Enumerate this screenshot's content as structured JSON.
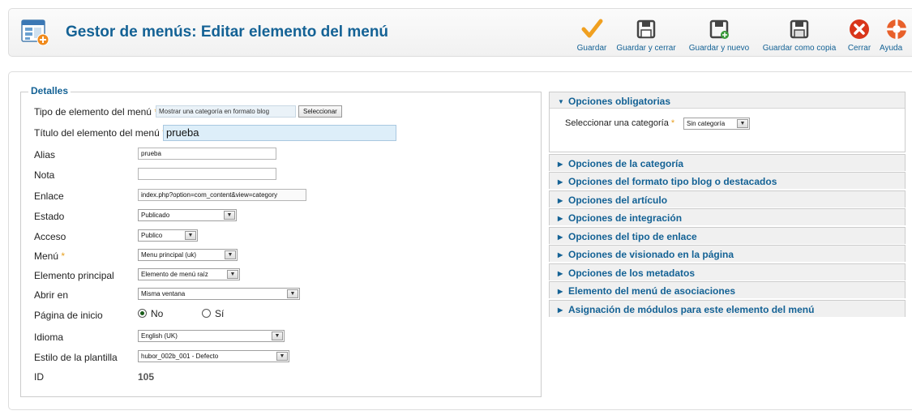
{
  "header": {
    "title": "Gestor de menús: Editar elemento del menú",
    "toolbar": [
      {
        "label": "Guardar",
        "icon": "checkmark-icon"
      },
      {
        "label": "Guardar y cerrar",
        "icon": "save-close-icon"
      },
      {
        "label": "Guardar y nuevo",
        "icon": "save-new-icon"
      },
      {
        "label": "Guardar como copia",
        "icon": "save-copy-icon"
      },
      {
        "label": "Cerrar",
        "icon": "close-icon"
      },
      {
        "label": "Ayuda",
        "icon": "help-icon"
      }
    ]
  },
  "details": {
    "legend": "Detalles",
    "required_marker": "*",
    "menu_item_type": {
      "label": "Tipo de elemento del menú",
      "value": "Mostrar una categoría en formato blog",
      "button": "Seleccionar"
    },
    "title": {
      "label": "Título del elemento del menú",
      "value": "prueba"
    },
    "alias": {
      "label": "Alias",
      "value": "prueba"
    },
    "note": {
      "label": "Nota",
      "value": ""
    },
    "link": {
      "label": "Enlace",
      "value": "index.php?option=com_content&view=category"
    },
    "status": {
      "label": "Estado",
      "value": "Publicado"
    },
    "access": {
      "label": "Acceso",
      "value": "Publico"
    },
    "menu": {
      "label": "Menú",
      "value": "Menu principal (uk)"
    },
    "parent": {
      "label": "Elemento principal",
      "value": "Elemento de menú raíz"
    },
    "open_in": {
      "label": "Abrir en",
      "value": "Misma ventana"
    },
    "home": {
      "label": "Página de inicio",
      "options": [
        "No",
        "Sí"
      ],
      "selected": "No"
    },
    "language": {
      "label": "Idioma",
      "value": "English (UK)"
    },
    "template_style": {
      "label": "Estilo de la plantilla",
      "value": "hubor_002b_001 - Defecto"
    },
    "id": {
      "label": "ID",
      "value": "105"
    }
  },
  "options": {
    "required": {
      "title": "Opciones obligatorias",
      "category_label": "Seleccionar una categoría",
      "category_value": "Sin categoría"
    },
    "collapsed": [
      "Opciones de la categoría",
      "Opciones del formato tipo blog o destacados",
      "Opciones del artículo",
      "Opciones de integración",
      "Opciones del tipo de enlace",
      "Opciones de visionado en la página",
      "Opciones de los metadatos",
      "Elemento del menú de asociaciones",
      "Asignación de módulos para este elemento del menú"
    ]
  },
  "colors": {
    "accent": "#146295",
    "required": "#e8a022",
    "close": "#d9361b"
  }
}
